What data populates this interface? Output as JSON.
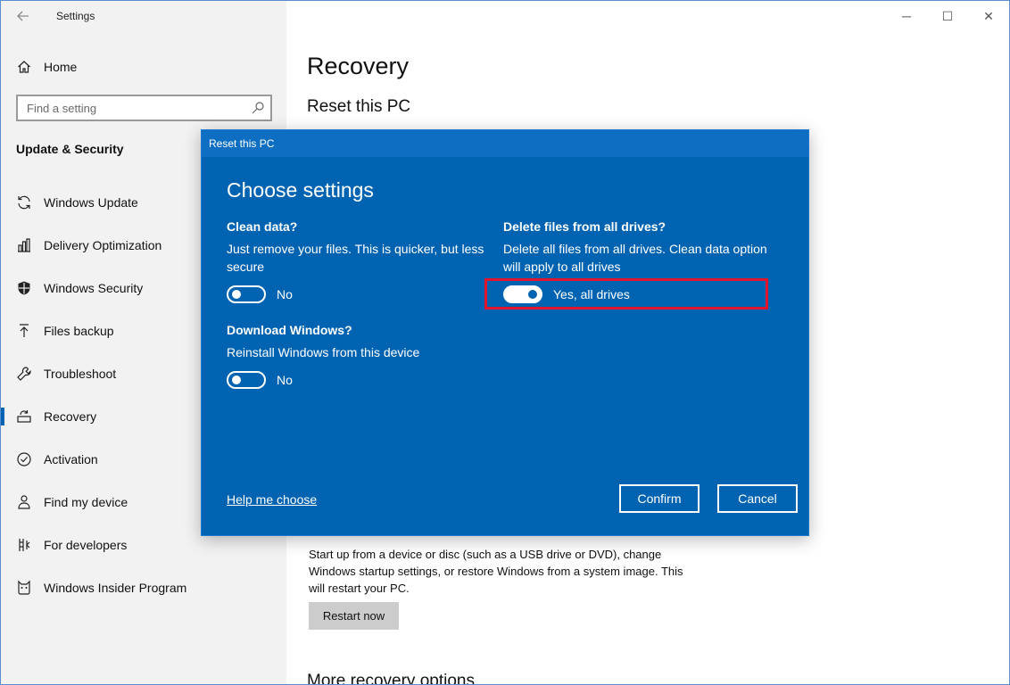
{
  "app": {
    "title": "Settings",
    "back_icon": "back-arrow-icon"
  },
  "window_controls": {
    "minimize": "─",
    "maximize": "☐",
    "close": "✕"
  },
  "sidebar": {
    "home_label": "Home",
    "search_placeholder": "Find a setting",
    "section_title": "Update & Security",
    "items": [
      {
        "label": "Windows Update",
        "icon": "sync-icon",
        "active": false
      },
      {
        "label": "Delivery Optimization",
        "icon": "delivery-icon",
        "active": false
      },
      {
        "label": "Windows Security",
        "icon": "shield-icon",
        "active": false
      },
      {
        "label": "Files backup",
        "icon": "upload-icon",
        "active": false
      },
      {
        "label": "Troubleshoot",
        "icon": "wrench-icon",
        "active": false
      },
      {
        "label": "Recovery",
        "icon": "recovery-icon",
        "active": true
      },
      {
        "label": "Activation",
        "icon": "check-circle-icon",
        "active": false
      },
      {
        "label": "Find my device",
        "icon": "person-pin-icon",
        "active": false
      },
      {
        "label": "For developers",
        "icon": "developer-icon",
        "active": false
      },
      {
        "label": "Windows Insider Program",
        "icon": "insider-cat-icon",
        "active": false
      }
    ]
  },
  "main": {
    "title": "Recovery",
    "reset_heading": "Reset this PC",
    "advanced_text": "Start up from a device or disc (such as a USB drive or DVD), change Windows startup settings, or restore Windows from a system image. This will restart your PC.",
    "restart_label": "Restart now",
    "more_options_heading": "More recovery options"
  },
  "dialog": {
    "title": "Reset this PC",
    "heading": "Choose settings",
    "clean_data": {
      "title": "Clean data?",
      "desc": "Just remove your files. This is quicker, but less secure",
      "state": "No",
      "on": false
    },
    "delete_files": {
      "title": "Delete files from all drives?",
      "desc": "Delete all files from all drives. Clean data option will apply to all drives",
      "state": "Yes, all drives",
      "on": true
    },
    "download_windows": {
      "title": "Download Windows?",
      "desc": "Reinstall Windows from this device",
      "state": "No",
      "on": false
    },
    "help_link": "Help me choose",
    "confirm_label": "Confirm",
    "cancel_label": "Cancel",
    "colors": {
      "dialog_bg": "#0063b1",
      "highlight": "#e0142a"
    }
  }
}
